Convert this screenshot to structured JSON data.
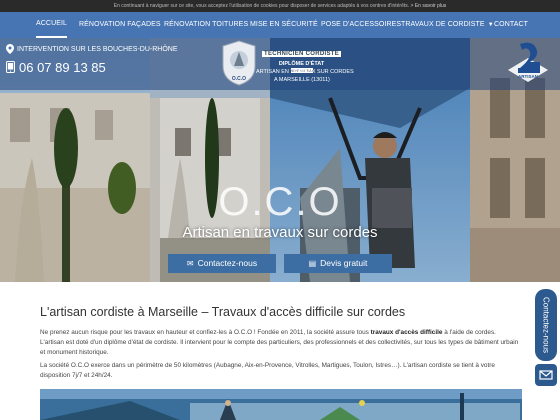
{
  "cookie_notice": {
    "text": "En continuant à naviguer sur ce site, vous acceptez l'utilisation de cookies pour disposer de services adaptés à vos centres d'intérêts.",
    "more_link": "> En savoir plus"
  },
  "nav": {
    "items": [
      {
        "label": "ACCUEIL"
      },
      {
        "label": "RÉNOVATION FAÇADES"
      },
      {
        "label": "RÉNOVATION TOITURES"
      },
      {
        "label": "MISE EN SÉCURITÉ"
      },
      {
        "label": "POSE D'ACCESSOIRES"
      },
      {
        "label": "TRAVAUX DE CORDISTE"
      },
      {
        "label": "CONTACT"
      }
    ],
    "active_index": 0
  },
  "header": {
    "location": "INTERVENTION SUR LES BOUCHES-DU-RHÔNE",
    "phone": "06 07 89 13 85",
    "logo_badge_text": "O.C.O",
    "logo_line1": "TECHNICIEN CORDISTE",
    "logo_line2": "DIPLÔME D'ÉTAT",
    "logo_line3": "NIVEAU BAC 2",
    "logo_sub1": "ARTISAN EN TRAVAUX SUR CORDES",
    "logo_sub2": "A MARSEILLE (13011)",
    "artisan_label": "ARTISAN"
  },
  "hero": {
    "brand": "O.C.O",
    "tagline": "Artisan en travaux sur cordes",
    "cta_contact": "Contactez-nous",
    "cta_quote": "Devis gratuit"
  },
  "content": {
    "title": "L'artisan cordiste à Marseille – Travaux d'accès difficile sur cordes",
    "p1_before": "Ne prenez aucun risque pour les travaux en hauteur et confiez-les à O.C.O ! Fondée en 2011, la société assure tous ",
    "p1_bold": "travaux d'accès difficile",
    "p1_after": " à l'aide de cordes.",
    "p2": "L'artisan est doté d'un diplôme d'état de cordiste. Il intervient pour le compte des particuliers, des professionnels et des collectivités, sur tous les types de bâtiment urbain et monument historique.",
    "p3": "La société O.C.O exerce dans un périmètre de 50 kilomètres (Aubagne, Aix-en-Provence, Vitrolles, Martigues, Toulon, Istres…). L'artisan cordiste se tient à votre disposition 7j/7 et 24h/24."
  },
  "side": {
    "contact_tab": "Contactez-nous"
  },
  "colors": {
    "nav_blue": "#4775b4",
    "cta_blue": "#3d6ea3",
    "side_blue": "#2c5a8f"
  }
}
